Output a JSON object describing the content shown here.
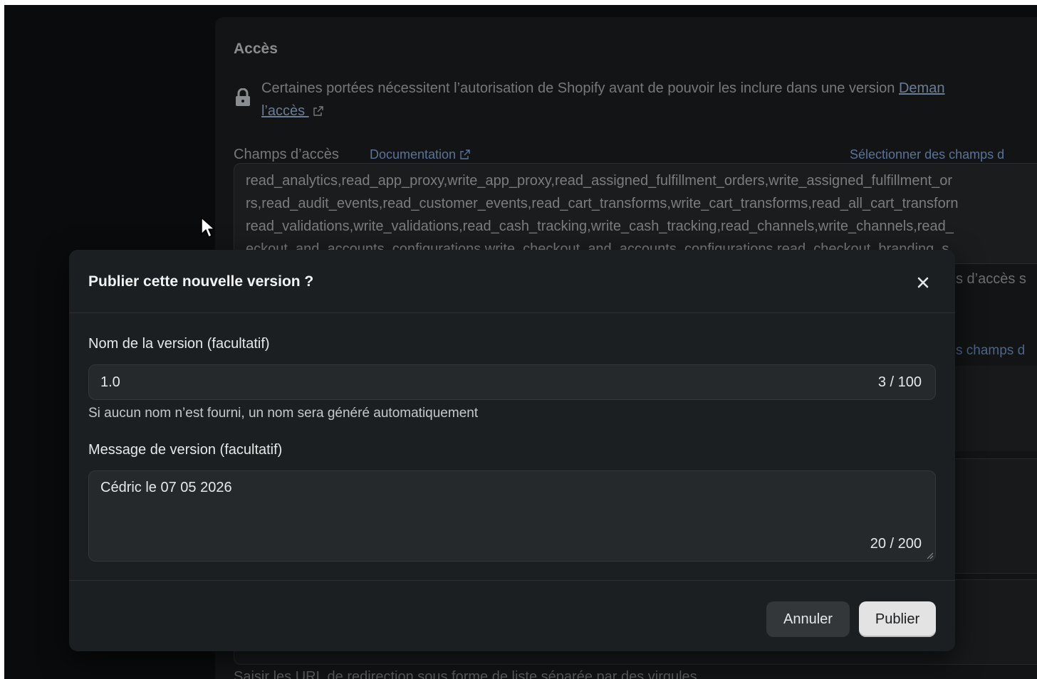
{
  "background": {
    "section_title": "Accès",
    "notice_text": "Certaines portées nécessitent l’autorisation de Shopify avant de pouvoir les inclure dans une version ",
    "notice_link_part1": "Deman",
    "notice_link_part2": "l’accès ",
    "fields_label": "Champs d’accès",
    "documentation_link": "Documentation",
    "select_fields_link": "Sélectionner des champs d",
    "scopes_lines": [
      "read_analytics,read_app_proxy,write_app_proxy,read_assigned_fulfillment_orders,write_assigned_fulfillment_or",
      "rs,read_audit_events,read_customer_events,read_cart_transforms,write_cart_transforms,read_all_cart_transforn",
      "read_validations,write_validations,read_cash_tracking,write_cash_tracking,read_channels,write_channels,read_",
      "eckout_and_accounts_configurations,write_checkout_and_accounts_configurations,read_checkout_branding_s"
    ],
    "side_text_1": "s d’accès s",
    "side_text_2": "s champs d",
    "footer_text": "Saisir les URL de redirection sous forme de liste séparée par des virgules"
  },
  "modal": {
    "title": "Publier cette nouvelle version ?",
    "close_icon": "close-icon",
    "version_name_label": "Nom de la version (facultatif)",
    "version_name_value": "1.0",
    "version_name_counter": "3 / 100",
    "version_name_helper": "Si aucun nom n’est fourni, un nom sera généré automatiquement",
    "message_label": "Message de version (facultatif)",
    "message_value": "Cédric le 07 05 2026",
    "message_counter": "20 / 200",
    "cancel_label": "Annuler",
    "publish_label": "Publier"
  }
}
